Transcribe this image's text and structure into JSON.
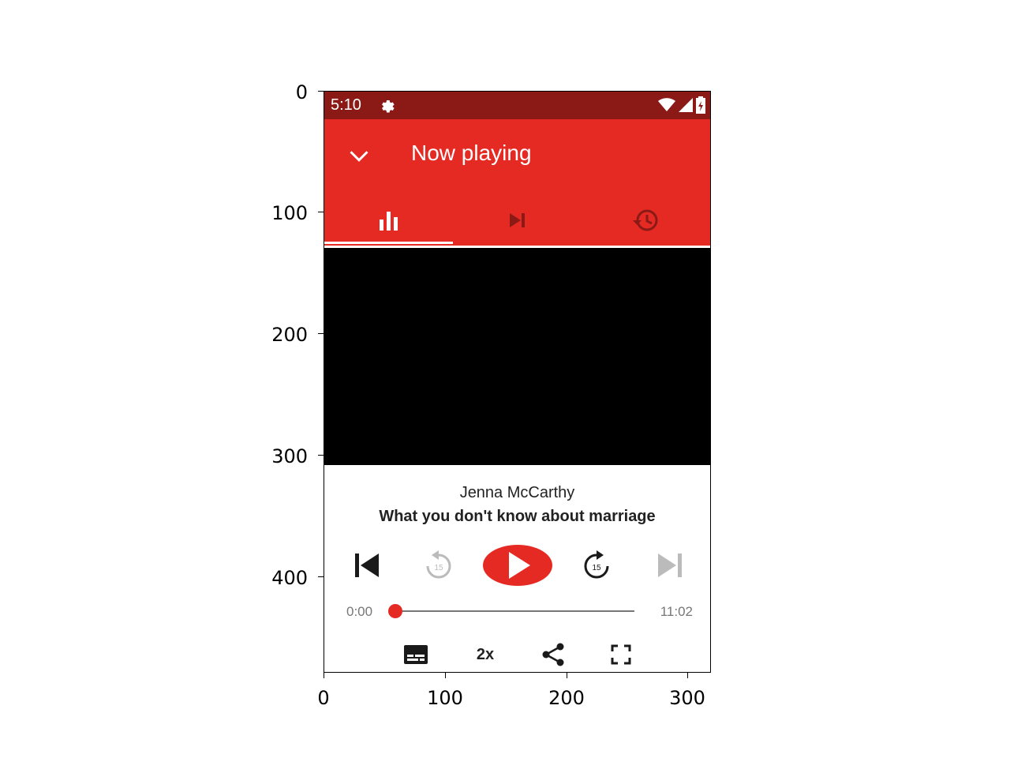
{
  "axes": {
    "y_ticks": [
      "0",
      "100",
      "200",
      "300",
      "400"
    ],
    "x_ticks": [
      "0",
      "100",
      "200",
      "300"
    ]
  },
  "status_bar": {
    "time": "5:10",
    "icons": [
      "gear-icon",
      "wifi-icon",
      "signal-icon",
      "battery-icon"
    ]
  },
  "app_bar": {
    "title": "Now playing",
    "back_icon": "chevron-down-icon",
    "tabs": [
      {
        "icon": "equalizer-icon",
        "active": true
      },
      {
        "icon": "skip-next-icon",
        "active": false
      },
      {
        "icon": "history-icon",
        "active": false
      }
    ]
  },
  "player": {
    "author": "Jenna McCarthy",
    "title": "What you don't know about marriage",
    "time_current": "0:00",
    "time_total": "11:02",
    "progress": 0,
    "speed": "2x",
    "replay_seconds": "15",
    "forward_seconds": "15"
  },
  "colors": {
    "status_bar": "#8b1a17",
    "accent": "#e52a24",
    "text": "#222222",
    "muted": "#777777"
  }
}
